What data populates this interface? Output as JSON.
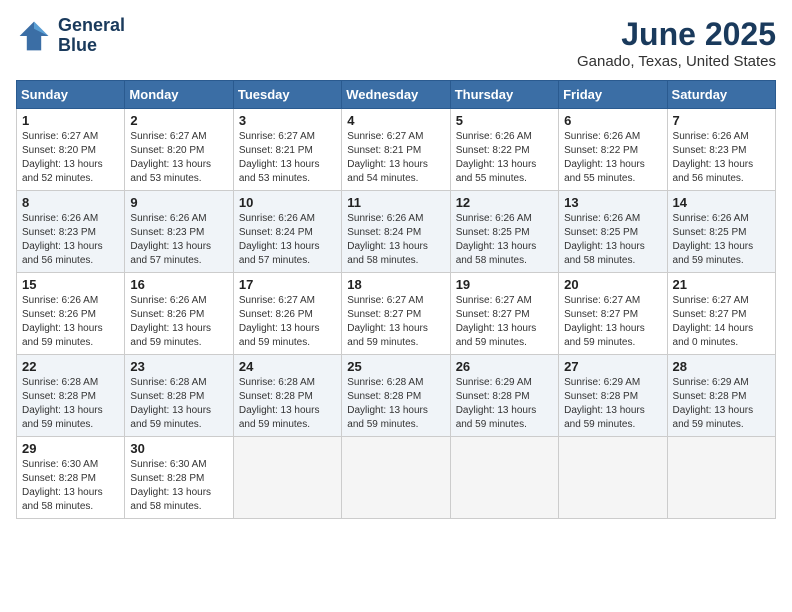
{
  "header": {
    "logo_line1": "General",
    "logo_line2": "Blue",
    "month_title": "June 2025",
    "location": "Ganado, Texas, United States"
  },
  "weekdays": [
    "Sunday",
    "Monday",
    "Tuesday",
    "Wednesday",
    "Thursday",
    "Friday",
    "Saturday"
  ],
  "weeks": [
    [
      {
        "day": "1",
        "rise": "6:27 AM",
        "set": "8:20 PM",
        "hours": "13 hours and 52 minutes."
      },
      {
        "day": "2",
        "rise": "6:27 AM",
        "set": "8:20 PM",
        "hours": "13 hours and 53 minutes."
      },
      {
        "day": "3",
        "rise": "6:27 AM",
        "set": "8:21 PM",
        "hours": "13 hours and 53 minutes."
      },
      {
        "day": "4",
        "rise": "6:27 AM",
        "set": "8:21 PM",
        "hours": "13 hours and 54 minutes."
      },
      {
        "day": "5",
        "rise": "6:26 AM",
        "set": "8:22 PM",
        "hours": "13 hours and 55 minutes."
      },
      {
        "day": "6",
        "rise": "6:26 AM",
        "set": "8:22 PM",
        "hours": "13 hours and 55 minutes."
      },
      {
        "day": "7",
        "rise": "6:26 AM",
        "set": "8:23 PM",
        "hours": "13 hours and 56 minutes."
      }
    ],
    [
      {
        "day": "8",
        "rise": "6:26 AM",
        "set": "8:23 PM",
        "hours": "13 hours and 56 minutes."
      },
      {
        "day": "9",
        "rise": "6:26 AM",
        "set": "8:23 PM",
        "hours": "13 hours and 57 minutes."
      },
      {
        "day": "10",
        "rise": "6:26 AM",
        "set": "8:24 PM",
        "hours": "13 hours and 57 minutes."
      },
      {
        "day": "11",
        "rise": "6:26 AM",
        "set": "8:24 PM",
        "hours": "13 hours and 58 minutes."
      },
      {
        "day": "12",
        "rise": "6:26 AM",
        "set": "8:25 PM",
        "hours": "13 hours and 58 minutes."
      },
      {
        "day": "13",
        "rise": "6:26 AM",
        "set": "8:25 PM",
        "hours": "13 hours and 58 minutes."
      },
      {
        "day": "14",
        "rise": "6:26 AM",
        "set": "8:25 PM",
        "hours": "13 hours and 59 minutes."
      }
    ],
    [
      {
        "day": "15",
        "rise": "6:26 AM",
        "set": "8:26 PM",
        "hours": "13 hours and 59 minutes."
      },
      {
        "day": "16",
        "rise": "6:26 AM",
        "set": "8:26 PM",
        "hours": "13 hours and 59 minutes."
      },
      {
        "day": "17",
        "rise": "6:27 AM",
        "set": "8:26 PM",
        "hours": "13 hours and 59 minutes."
      },
      {
        "day": "18",
        "rise": "6:27 AM",
        "set": "8:27 PM",
        "hours": "13 hours and 59 minutes."
      },
      {
        "day": "19",
        "rise": "6:27 AM",
        "set": "8:27 PM",
        "hours": "13 hours and 59 minutes."
      },
      {
        "day": "20",
        "rise": "6:27 AM",
        "set": "8:27 PM",
        "hours": "13 hours and 59 minutes."
      },
      {
        "day": "21",
        "rise": "6:27 AM",
        "set": "8:27 PM",
        "hours": "14 hours and 0 minutes."
      }
    ],
    [
      {
        "day": "22",
        "rise": "6:28 AM",
        "set": "8:28 PM",
        "hours": "13 hours and 59 minutes."
      },
      {
        "day": "23",
        "rise": "6:28 AM",
        "set": "8:28 PM",
        "hours": "13 hours and 59 minutes."
      },
      {
        "day": "24",
        "rise": "6:28 AM",
        "set": "8:28 PM",
        "hours": "13 hours and 59 minutes."
      },
      {
        "day": "25",
        "rise": "6:28 AM",
        "set": "8:28 PM",
        "hours": "13 hours and 59 minutes."
      },
      {
        "day": "26",
        "rise": "6:29 AM",
        "set": "8:28 PM",
        "hours": "13 hours and 59 minutes."
      },
      {
        "day": "27",
        "rise": "6:29 AM",
        "set": "8:28 PM",
        "hours": "13 hours and 59 minutes."
      },
      {
        "day": "28",
        "rise": "6:29 AM",
        "set": "8:28 PM",
        "hours": "13 hours and 59 minutes."
      }
    ],
    [
      {
        "day": "29",
        "rise": "6:30 AM",
        "set": "8:28 PM",
        "hours": "13 hours and 58 minutes."
      },
      {
        "day": "30",
        "rise": "6:30 AM",
        "set": "8:28 PM",
        "hours": "13 hours and 58 minutes."
      },
      null,
      null,
      null,
      null,
      null
    ]
  ],
  "labels": {
    "sunrise": "Sunrise: ",
    "sunset": "Sunset: ",
    "daylight": "Daylight: "
  }
}
